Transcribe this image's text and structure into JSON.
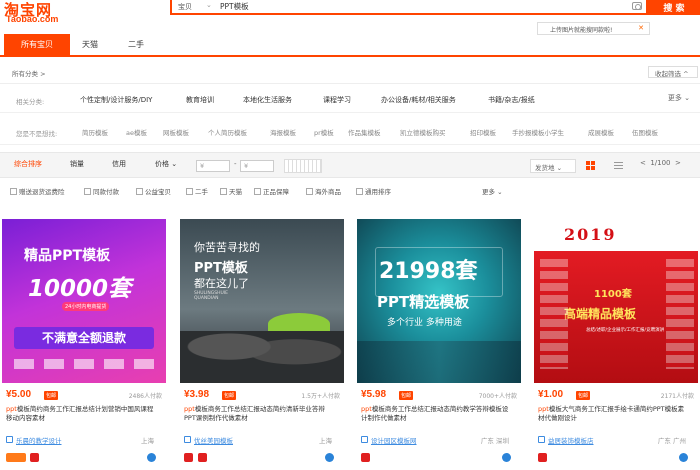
{
  "header": {
    "logo_cn": "淘宝网",
    "logo_en": "Taobao.com",
    "search_category": "宝贝",
    "search_value": "PPT模板",
    "search_button": "搜 索",
    "upload_tip": "上传图片就能搜同款啦!",
    "camera_icon": "camera-icon"
  },
  "tabs": [
    "所有宝贝",
    "天猫",
    "二手"
  ],
  "breadcrumb": "所有分类 >",
  "collapse_label": "收起筛选 ^",
  "filters": {
    "related_label": "相关分类:",
    "related_items": [
      "个性定制/设计服务/DIY",
      "教育培训",
      "本地化生活服务",
      "课程学习",
      "办公设备/耗材/相关服务",
      "书籍/杂志/报纸"
    ],
    "more_label": "更多",
    "choice_label": "您是不是想找:",
    "choice_items": [
      "简历模板",
      "ae模板",
      "网板模板",
      "个人简历模板",
      "海报模板",
      "pr模板",
      "作品集模板",
      "凯立德模板购买",
      "招印模板",
      "手抄报模板小学生",
      "成展模板",
      "伍图模板"
    ]
  },
  "sortbar": {
    "tabs": [
      "综合排序",
      "销量",
      "信用",
      "价格"
    ],
    "price_from": "¥",
    "price_to": "¥",
    "dash": "-",
    "location": "发货地",
    "page_info": "1/100",
    "prev": "<",
    "next": ">"
  },
  "checks": [
    "赠送退货运费险",
    "同款付款",
    "公益宝贝",
    "二手",
    "天猫",
    "正品保障",
    "海外商品",
    "通用排序"
  ],
  "checks_more": "更多",
  "products": [
    {
      "price": "¥5.00",
      "badge": "包邮",
      "payers": "2486人付款",
      "title_hl": "ppt",
      "title": "模板简约商务工作汇报总结计划营销中国风课程移动内容素材",
      "shop": "乐晨的教学设计",
      "location": "上海",
      "image_lines": [
        "精品PPT模板",
        "10000套",
        "不满意全额退款"
      ],
      "image_sub": "24小时内电商提货"
    },
    {
      "price": "¥3.98",
      "badge": "包邮",
      "payers": "1.5万+人付款",
      "title_hl": "ppt",
      "title": "模板商务工作总结汇报动态简约清新毕业答辩PPT课例制作代做素材",
      "shop": "优丝美园模板",
      "location": "上海",
      "image_lines": [
        "你苦苦寻找的",
        "PPT模板",
        "都在这儿了"
      ],
      "image_sub": "SHULINGSHUIE QUANDIAN"
    },
    {
      "price": "¥5.98",
      "badge": "包邮",
      "payers": "7000+人付款",
      "title_hl": "ppt",
      "title": "模板商务工作总结汇报动态简约教学答辩模板设计制作代做素材",
      "shop": "设计园区模板网",
      "location": "广东 深圳",
      "image_lines": [
        "21998套",
        "PPT精选模板",
        "多个行业 多种用途"
      ],
      "image_sub": ""
    },
    {
      "price": "¥1.00",
      "badge": "包邮",
      "payers": "2171人付款",
      "title_hl": "ppt",
      "title": "模板大气商务工作汇报手绘卡通简约PPT模板素材代做刚设计",
      "shop": "益居装饰模板店",
      "location": "广东 广州",
      "image_lines": [
        "2019",
        "1100套",
        "高端精品模板"
      ],
      "image_sub": "总结/述职/企业展示/工作汇报/竞聘演讲"
    }
  ],
  "colors": {
    "accent": "#ff4400",
    "link": "#3d8be0"
  }
}
